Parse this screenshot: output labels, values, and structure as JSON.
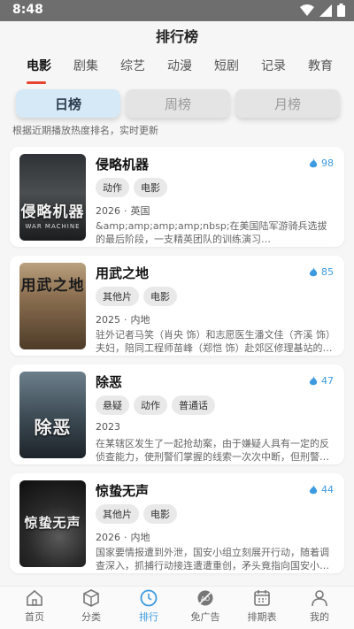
{
  "status": {
    "time": "8:48"
  },
  "header": {
    "title": "排行榜"
  },
  "tabs": [
    "电影",
    "剧集",
    "综艺",
    "动漫",
    "短剧",
    "记录",
    "教育"
  ],
  "rank_buttons": [
    "日榜",
    "周榜",
    "月榜"
  ],
  "subtitle": "根据近期播放热度排名，实时更新",
  "colors": {
    "accent_red": "#e8432f",
    "accent_blue": "#3d9ae0"
  },
  "cards": [
    {
      "title": "侵略机器",
      "score": "98",
      "tags": [
        "动作",
        "电影"
      ],
      "year": "2026",
      "region": "英国",
      "desc": "&amp;amp;amp;amp;nbsp;在美国陆军游骑兵选拔的最后阶段，一支精英团队的训练演习…",
      "poster_text": "侵略机器",
      "poster_sub": "WAR MACHINE"
    },
    {
      "title": "用武之地",
      "score": "85",
      "tags": [
        "其他片",
        "电影"
      ],
      "year": "2025",
      "region": "内地",
      "desc": "驻外记者马笑（肖央 饰）和志愿医生潘文佳（齐溪 饰）夫妇，陪同工程师苗峰（郑恺 饰）赴郊区修理基站的…",
      "poster_text": "用武之地",
      "poster_sub": ""
    },
    {
      "title": "除恶",
      "score": "47",
      "tags": [
        "悬疑",
        "动作",
        "普通话"
      ],
      "year": "2023",
      "region": "",
      "desc": "在某辖区发生了一起抢劫案，由于嫌疑人具有一定的反侦查能力，使刑警们掌握的线索一次次中断，但刑警…",
      "poster_text": "除恶",
      "poster_sub": ""
    },
    {
      "title": "惊蛰无声",
      "score": "44",
      "tags": [
        "其他片",
        "电影"
      ],
      "year": "2026",
      "region": "内地",
      "desc": "国家要情报遭到外泄，国安小组立刻展开行动，随着调查深入，抓捕行动接连遭遭重创，矛头竟指向国安小…",
      "poster_text": "惊蛰无声",
      "poster_sub": ""
    }
  ],
  "bottom_nav": [
    "首页",
    "分类",
    "排行",
    "免广告",
    "排期表",
    "我的"
  ]
}
